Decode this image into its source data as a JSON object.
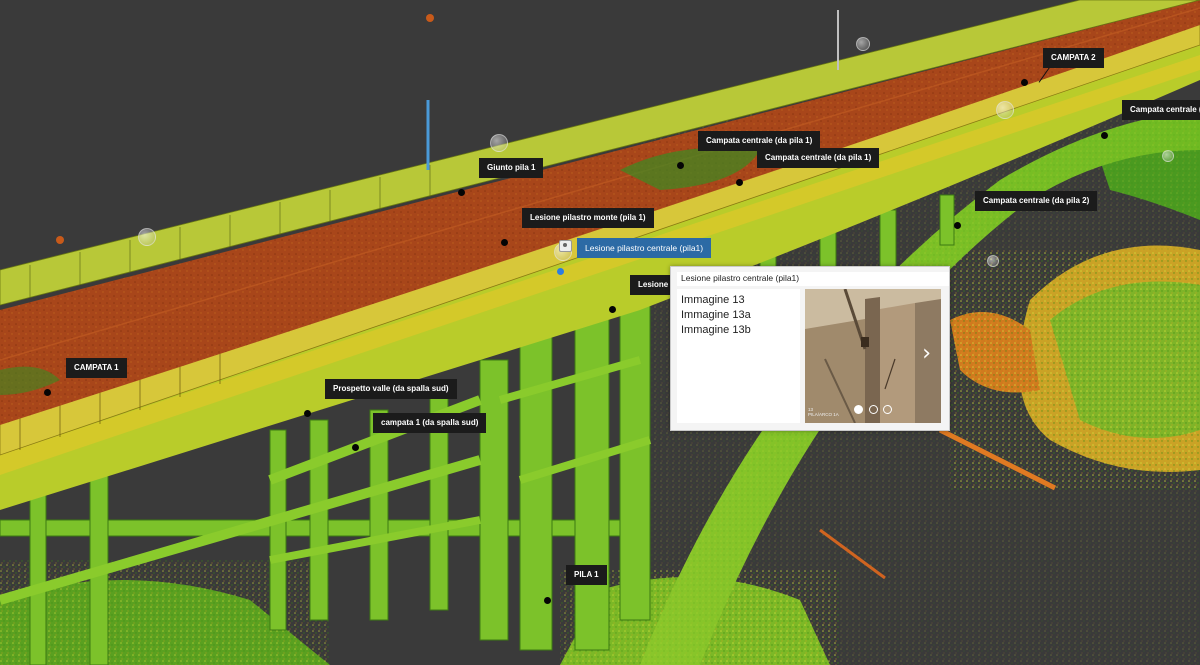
{
  "markers": {
    "campata_2": "CAMPATA 2",
    "campata_centrale_right": "Campata centrale (c",
    "campata_centrale_pila1_a": "Campata centrale (da pila 1)",
    "campata_centrale_pila1_b": "Campata centrale (da pila 1)",
    "campata_centrale_pila2": "Campata centrale (da pila 2)",
    "giunto_pila1": "Giunto pila 1",
    "lesione_monte": "Lesione pilastro monte (pila 1)",
    "lesione_centrale": "Lesione pilastro centrale (pila1)",
    "lesione_partial": "Lesione p",
    "campata_1": "CAMPATA 1",
    "prospetto_valle": "Prospetto valle (da spalla sud)",
    "campata_1_spalla": "campata 1 (da spalla sud)",
    "pila_1": "PILA 1"
  },
  "popup": {
    "title": "Lesione pilastro centrale (pila1)",
    "images": [
      "Immagine 13",
      "Immagine 13a",
      "Immagine 13b"
    ],
    "photo_caption_line1": "13",
    "photo_caption_line2": "PILA/ARCO 1A",
    "carousel_count": 3,
    "carousel_active": 0
  },
  "icons": {
    "next": "chevron-right-icon",
    "camera": "camera-icon",
    "panorama": "panorama-bubble-icon"
  },
  "colors": {
    "background": "#3a3a3a",
    "label_bg": "#1b1b1b",
    "label_active_bg": "#2c6aa5",
    "deck_red": "#a8461a",
    "structure_green": "#6fc21e",
    "structure_yellow": "#c6d22a"
  }
}
